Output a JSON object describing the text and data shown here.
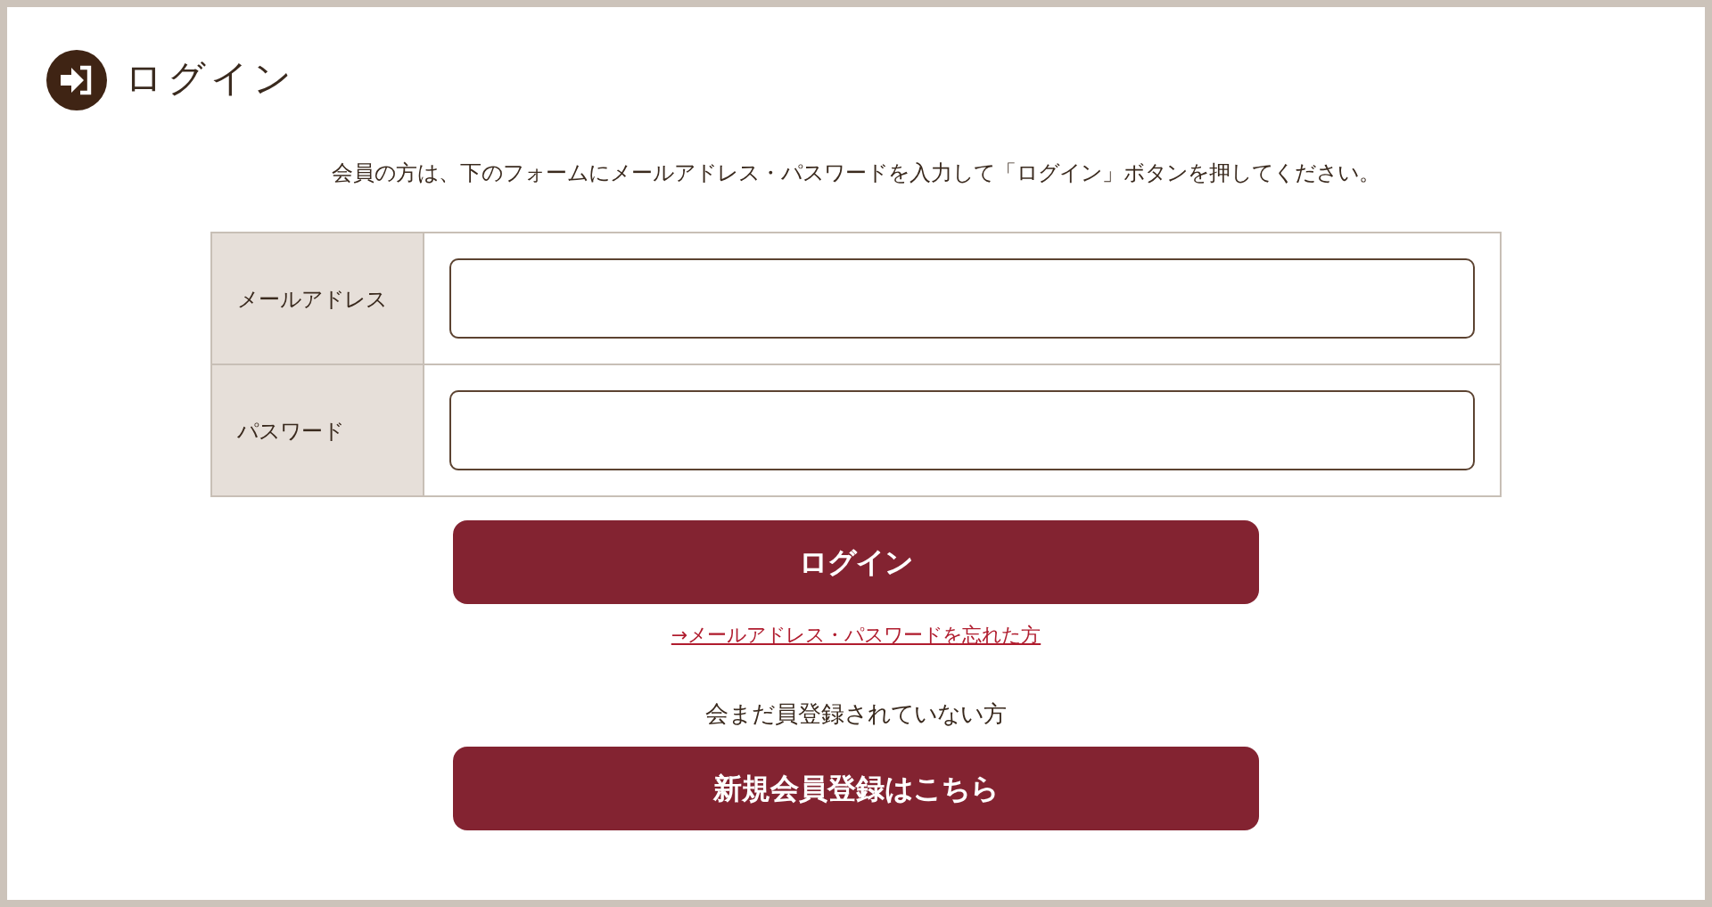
{
  "title": "ログイン",
  "intro": "会員の方は、下のフォームにメールアドレス・パスワードを入力して「ログイン」ボタンを押してください。",
  "fields": [
    {
      "label": "メールアドレス"
    },
    {
      "label": "パスワード"
    }
  ],
  "login_button": "ログイン",
  "forgot_link": "→メールアドレス・パスワードを忘れた方",
  "register_note": "会まだ員登録されていない方",
  "register_button": "新規会員登録はこちら"
}
